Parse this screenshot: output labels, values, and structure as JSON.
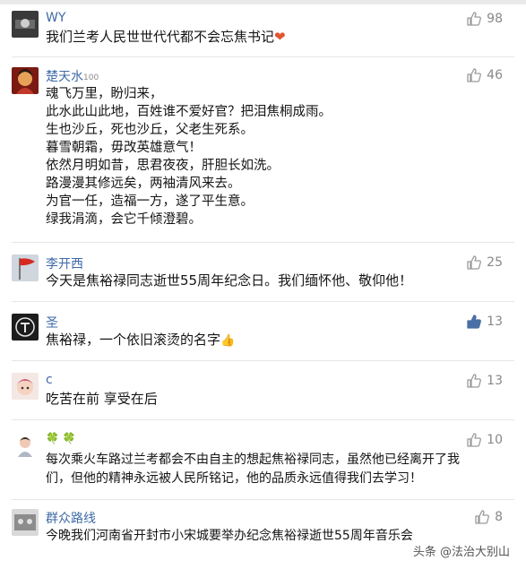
{
  "comments": [
    {
      "user": "WY",
      "likes": "98",
      "text": "我们兰考人民世世代代都不会忘焦书记",
      "emoji": "heart"
    },
    {
      "user": "楚天水",
      "user_badge": "100",
      "likes": "46",
      "lines": [
        "魂飞万里，盼归来，",
        "此水此山此地，百姓谁不爱好官？把泪焦桐成雨。",
        "生也沙丘，死也沙丘，父老生死系。",
        "暮雪朝霜，毋改英雄意气！",
        "依然月明如昔，思君夜夜，肝胆长如洗。",
        "路漫漫其修远矣，两袖清风来去。",
        "为官一任，造福一方，遂了平生意。",
        "绿我涓滴，会它千倾澄碧。"
      ]
    },
    {
      "user": "李开西",
      "likes": "25",
      "text": "今天是焦裕禄同志逝世55周年纪念日。我们缅怀他、敬仰他！"
    },
    {
      "user": "圣",
      "likes": "13",
      "liked": true,
      "text": "焦裕禄，一个依旧滚烫的名字",
      "emoji": "thumbs-up"
    },
    {
      "user": "c",
      "likes": "13",
      "text": "吃苦在前 享受在后"
    },
    {
      "user": "🍀 🍀",
      "likes": "10",
      "lines": [
        "每次乘火车路过兰考都会不由自主的想起焦裕禄同志，虽然他已经离开了我",
        "们，但他的精神永远被人民所铭记，他的品质永远值得我们去学习！"
      ]
    },
    {
      "user": "群众路线",
      "likes": "8",
      "text": "今晚我们河南省开封市小宋城要举办纪念焦裕禄逝世55周年音乐会"
    }
  ],
  "watermark": "头条 @法治大别山",
  "colors": {
    "name": "#3f6aa7",
    "like_liked": "#4a6fa5",
    "like": "#9a9a9a"
  }
}
